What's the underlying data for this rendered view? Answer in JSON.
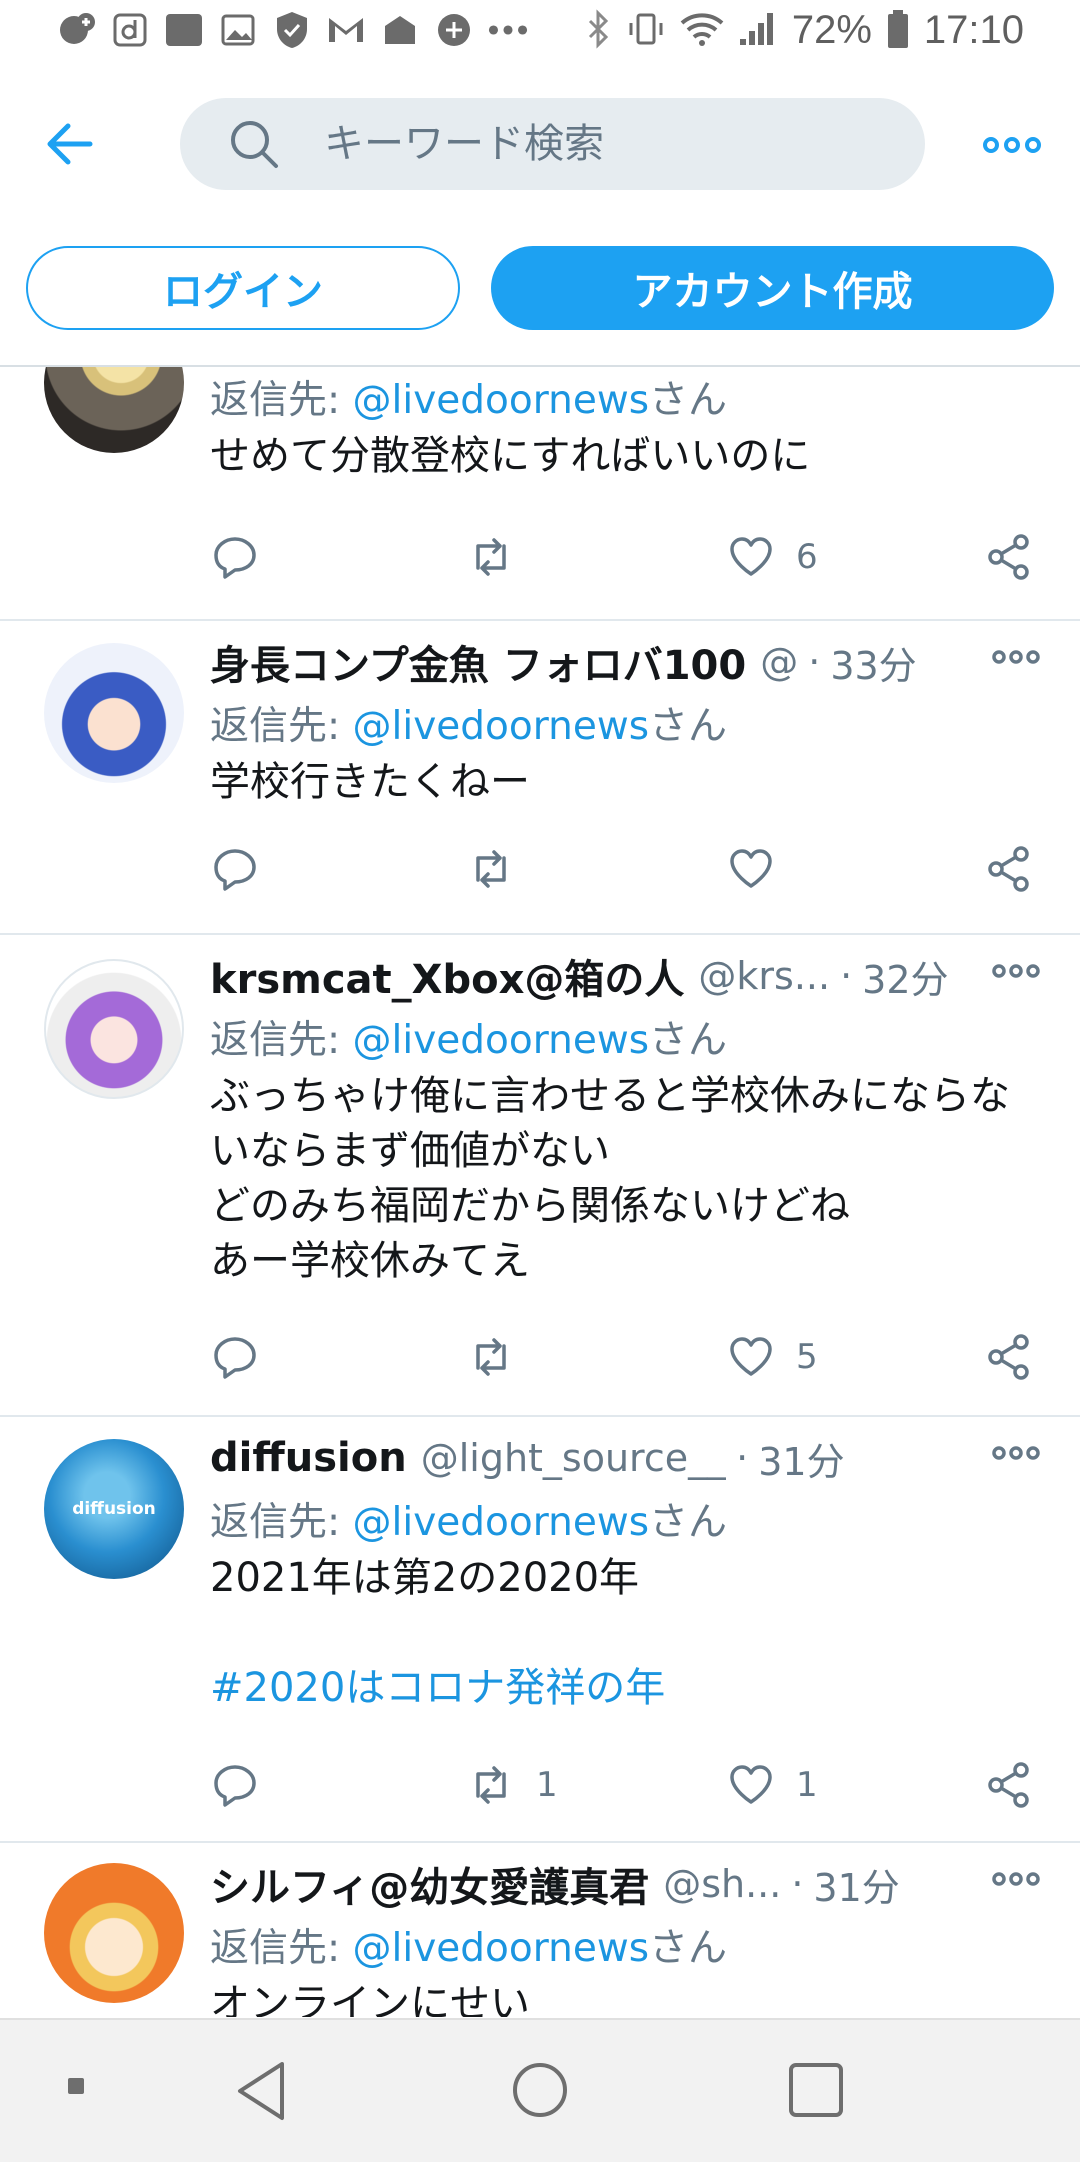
{
  "status_bar": {
    "battery": "72%",
    "time": "17:10"
  },
  "search": {
    "placeholder": "キーワード検索"
  },
  "auth": {
    "login_label": "ログイン",
    "signup_label": "アカウント作成"
  },
  "tweets": [
    {
      "name": "",
      "handle": "",
      "time": "",
      "reply_prefix": "返信先: ",
      "reply_mention": "@livedoornews",
      "reply_suffix": "さん",
      "text": "せめて分散登校にすればいいのに",
      "retweets": "",
      "likes": "6"
    },
    {
      "name": "身長コンプ金魚 フォロバ100",
      "handle": "@",
      "time": "33分",
      "reply_prefix": "返信先: ",
      "reply_mention": "@livedoornews",
      "reply_suffix": "さん",
      "text": "学校行きたくねー",
      "retweets": "",
      "likes": ""
    },
    {
      "name": "krsmcat_Xbox@箱の人",
      "handle": "@krs...",
      "time": "32分",
      "reply_prefix": "返信先: ",
      "reply_mention": "@livedoornews",
      "reply_suffix": "さん",
      "text": "ぶっちゃけ俺に言わせると学校休みにならないならまず価値がない\nどのみち福岡だから関係ないけどね\nあー学校休みてえ",
      "retweets": "",
      "likes": "5"
    },
    {
      "name": "diffusion",
      "handle": "@light_source__",
      "time": "31分",
      "reply_prefix": "返信先: ",
      "reply_mention": "@livedoornews",
      "reply_suffix": "さん",
      "text": "2021年は第2の2020年",
      "hashtag": "#2020はコロナ発祥の年",
      "avatar_text": "diffusion",
      "retweets": "1",
      "likes": "1"
    },
    {
      "name": "シルフィ@幼女愛護真君",
      "handle": "@sh...",
      "time": "31分",
      "reply_prefix": "返信先: ",
      "reply_mention": "@livedoornews",
      "reply_suffix": "さん",
      "text": "オンラインにせい",
      "retweets": "",
      "likes": ""
    }
  ],
  "colors": {
    "accent": "#1da1f2",
    "mention": "#1b95e0",
    "muted": "#657786"
  }
}
